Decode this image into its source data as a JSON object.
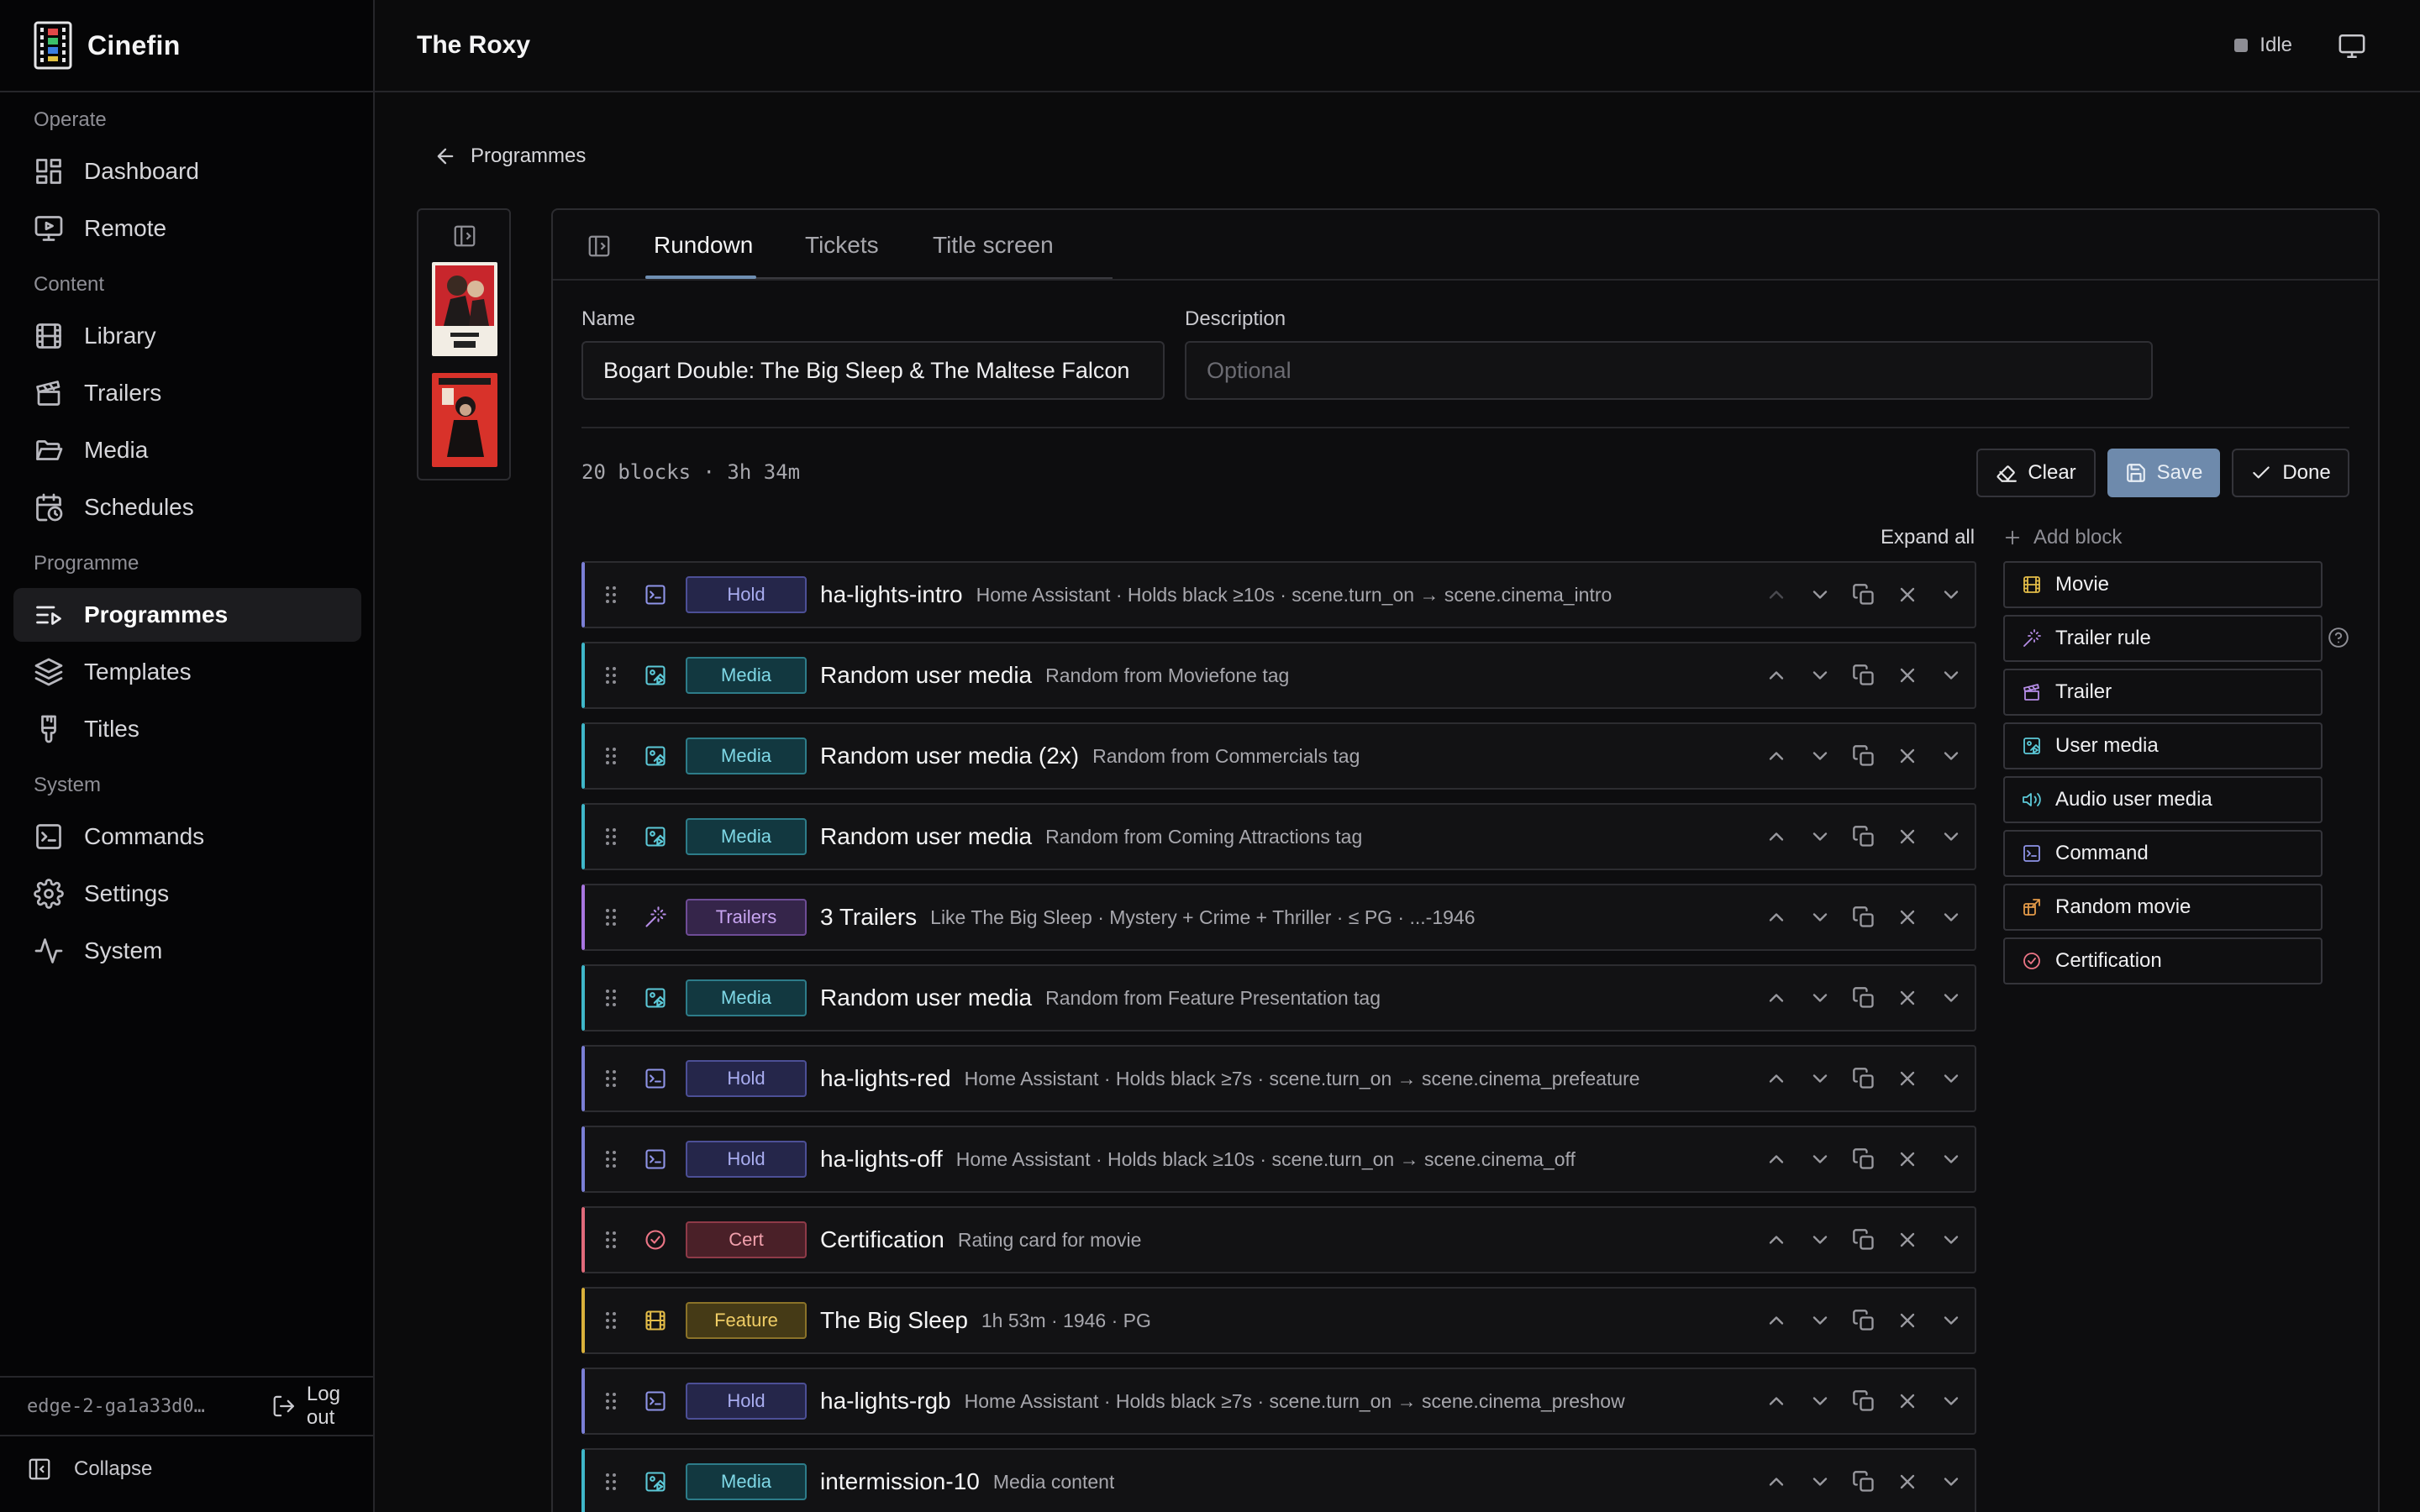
{
  "app": {
    "name": "Cinefin"
  },
  "header": {
    "title": "The Roxy",
    "status": "Idle"
  },
  "sidebar": {
    "groups": [
      {
        "label": "Operate",
        "items": [
          {
            "label": "Dashboard",
            "icon": "dashboard-icon"
          },
          {
            "label": "Remote",
            "icon": "remote-icon"
          }
        ]
      },
      {
        "label": "Content",
        "items": [
          {
            "label": "Library",
            "icon": "film-icon"
          },
          {
            "label": "Trailers",
            "icon": "clapper-icon"
          },
          {
            "label": "Media",
            "icon": "folder-icon"
          },
          {
            "label": "Schedules",
            "icon": "calendar-clock-icon"
          }
        ]
      },
      {
        "label": "Programme",
        "items": [
          {
            "label": "Programmes",
            "icon": "list-play-icon",
            "active": true
          },
          {
            "label": "Templates",
            "icon": "layers-icon"
          },
          {
            "label": "Titles",
            "icon": "brush-icon"
          }
        ]
      },
      {
        "label": "System",
        "items": [
          {
            "label": "Commands",
            "icon": "terminal-icon"
          },
          {
            "label": "Settings",
            "icon": "gear-icon"
          },
          {
            "label": "System",
            "icon": "activity-icon"
          }
        ]
      }
    ],
    "footer": {
      "instance": "edge-2-ga1a33d0…",
      "logout": "Log out",
      "collapse": "Collapse"
    }
  },
  "breadcrumb": {
    "back_label": "Programmes"
  },
  "editor": {
    "tabs": [
      {
        "label": "Rundown",
        "active": true
      },
      {
        "label": "Tickets"
      },
      {
        "label": "Title screen"
      }
    ],
    "name_label": "Name",
    "name_value": "Bogart Double: The Big Sleep & The Maltese Falcon",
    "description_label": "Description",
    "description_placeholder": "Optional",
    "summary": "20 blocks · 3h 34m",
    "actions": {
      "clear": "Clear",
      "save": "Save",
      "done": "Done"
    },
    "expand_all": "Expand all"
  },
  "blocks": [
    {
      "kind": "hold",
      "badge": "Hold",
      "title": "ha-lights-intro",
      "desc": "Home Assistant · Holds black ≥10s · scene.turn_on → scene.cinema_intro"
    },
    {
      "kind": "media",
      "badge": "Media",
      "title": "Random user media",
      "desc": "Random from Moviefone tag"
    },
    {
      "kind": "media",
      "badge": "Media",
      "title": "Random user media (2x)",
      "desc": "Random from Commercials tag"
    },
    {
      "kind": "media",
      "badge": "Media",
      "title": "Random user media",
      "desc": "Random from Coming Attractions tag"
    },
    {
      "kind": "trailers",
      "badge": "Trailers",
      "title": "3 Trailers",
      "desc": "Like The Big Sleep · Mystery + Crime + Thriller · ≤ PG · ...-1946"
    },
    {
      "kind": "media",
      "badge": "Media",
      "title": "Random user media",
      "desc": "Random from Feature Presentation tag"
    },
    {
      "kind": "hold",
      "badge": "Hold",
      "title": "ha-lights-red",
      "desc": "Home Assistant · Holds black ≥7s · scene.turn_on → scene.cinema_prefeature"
    },
    {
      "kind": "hold",
      "badge": "Hold",
      "title": "ha-lights-off",
      "desc": "Home Assistant · Holds black ≥10s · scene.turn_on → scene.cinema_off"
    },
    {
      "kind": "cert",
      "badge": "Cert",
      "title": "Certification",
      "desc": "Rating card for movie"
    },
    {
      "kind": "feature",
      "badge": "Feature",
      "title": "The Big Sleep",
      "desc": "1h 53m · 1946 · PG"
    },
    {
      "kind": "hold",
      "badge": "Hold",
      "title": "ha-lights-rgb",
      "desc": "Home Assistant · Holds black ≥7s · scene.turn_on → scene.cinema_preshow"
    },
    {
      "kind": "media",
      "badge": "Media",
      "title": "intermission-10",
      "desc": "Media content"
    }
  ],
  "add_block": {
    "label": "Add block",
    "items": [
      {
        "label": "Movie",
        "icon": "film-icon",
        "color": "#e3bc48"
      },
      {
        "label": "Trailer rule",
        "icon": "wand-icon",
        "color": "#b58ce6"
      },
      {
        "label": "Trailer",
        "icon": "clapper-icon",
        "color": "#b58ce6"
      },
      {
        "label": "User media",
        "icon": "image-play-icon",
        "color": "#5cc9d8"
      },
      {
        "label": "Audio user media",
        "icon": "speaker-icon",
        "color": "#5cc9d8"
      },
      {
        "label": "Command",
        "icon": "terminal-icon",
        "color": "#8f94e8"
      },
      {
        "label": "Random movie",
        "icon": "random-film-icon",
        "color": "#e39a48"
      },
      {
        "label": "Certification",
        "icon": "check-circle-icon",
        "color": "#ec7586"
      }
    ]
  }
}
